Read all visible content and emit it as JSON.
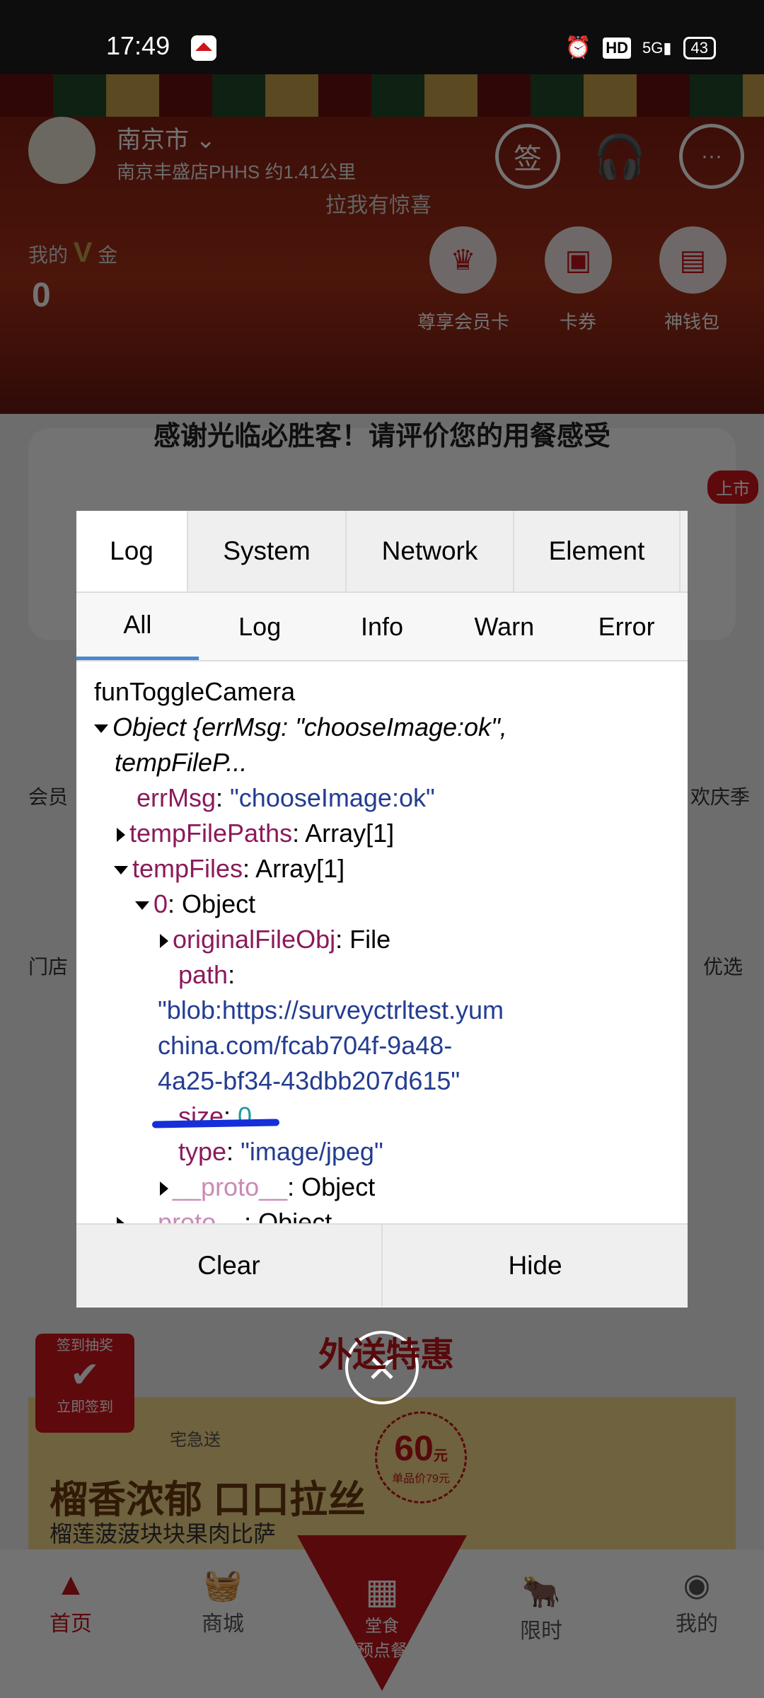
{
  "status_bar": {
    "time": "17:49",
    "hd": "HD",
    "network": "5G",
    "battery": "43"
  },
  "header": {
    "city": "南京市",
    "store": "南京丰盛店PHHS 约1.41公里",
    "pull_hint": "拉我有惊喜",
    "sign_icon_label": "签",
    "my_v_gold_label": "我的",
    "v_letter": "V",
    "gold_label": "金",
    "v_gold_value": "0"
  },
  "quick_actions": [
    {
      "label": "尊享会员卡"
    },
    {
      "label": "卡券"
    },
    {
      "label": "神钱包"
    }
  ],
  "survey": {
    "title": "感谢光临必胜客！请评价您的用餐感受",
    "badge": "上市"
  },
  "side_labels": {
    "left1": "会员",
    "right1": "欢庆季",
    "left2": "门店",
    "right2": "优选"
  },
  "promo": {
    "section_title": "外送特惠",
    "sign_in_badge": "签到抽奖",
    "sign_in_button": "立即签到",
    "delivery": "宅急送",
    "headline": "榴香浓郁 口口拉丝",
    "subtitle": "榴莲菠菠块块果肉比萨",
    "price": "60",
    "price_unit": "元",
    "original_price": "单品价79元"
  },
  "qr_button": {
    "line1": "堂食",
    "line2": "预点餐"
  },
  "bottom_nav": [
    {
      "label": "首页",
      "active": true
    },
    {
      "label": "商城"
    },
    {
      "label": "限时"
    },
    {
      "label": "我的"
    }
  ],
  "console": {
    "tabs": [
      "Log",
      "System",
      "Network",
      "Element"
    ],
    "active_tab": "Log",
    "subtabs": [
      "All",
      "Log",
      "Info",
      "Warn",
      "Error"
    ],
    "active_subtab": "All",
    "lines": {
      "l0": "funToggleCamera",
      "l1": "Object {errMsg: \"chooseImage:ok\",",
      "l1b": "tempFileP...",
      "errMsg_key": "errMsg",
      "errMsg_val": "\"chooseImage:ok\"",
      "tfp_key": "tempFilePaths",
      "tfp_val": "Array[1]",
      "tf_key": "tempFiles",
      "tf_val": "Array[1]",
      "idx_key": "0",
      "idx_val": "Object",
      "ofo_key": "originalFileObj",
      "ofo_val": "File",
      "path_key": "path",
      "path_1": "\"blob:https://surveyctrltest.yum",
      "path_2": "china.com/fcab704f-9a48-",
      "path_3": "4a25-bf34-43dbb207d615\"",
      "size_key": "size",
      "size_val": "0",
      "type_key": "type",
      "type_val": "\"image/jpeg\"",
      "proto_key": "__proto__",
      "proto_val": "Object",
      "proto2_key": "__proto__",
      "proto2_val": "Object"
    },
    "buttons": {
      "clear": "Clear",
      "hide": "Hide"
    }
  }
}
